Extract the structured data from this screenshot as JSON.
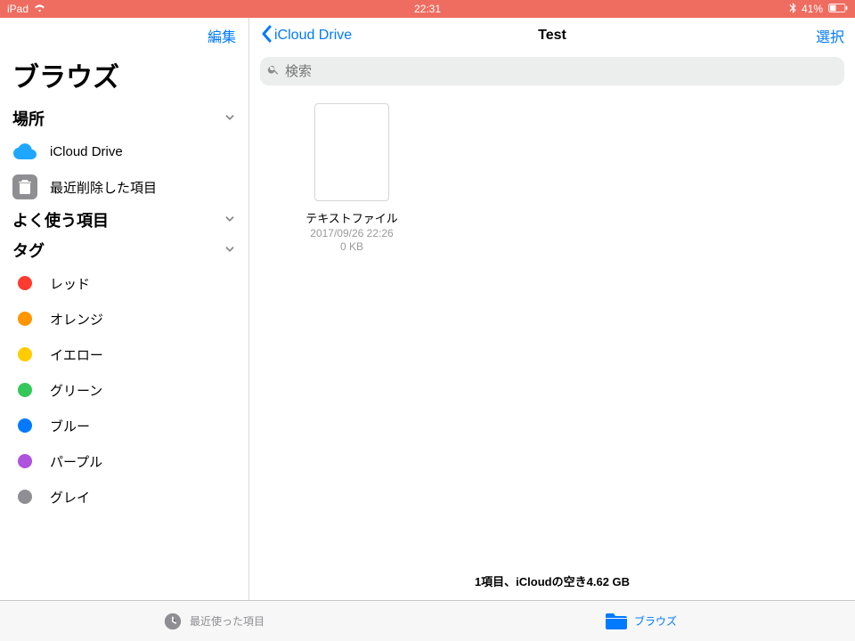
{
  "statusbar": {
    "device": "iPad",
    "time": "22:31",
    "battery_text": "41%"
  },
  "sidebar": {
    "edit_label": "編集",
    "title": "ブラウズ",
    "sections": {
      "locations": {
        "header": "場所"
      },
      "favorites": {
        "header": "よく使う項目"
      },
      "tags": {
        "header": "タグ"
      }
    },
    "locations": {
      "icloud": {
        "label": "iCloud Drive"
      },
      "recently_deleted": {
        "label": "最近削除した項目"
      }
    },
    "tags": [
      {
        "label": "レッド",
        "color": "#ff3b30"
      },
      {
        "label": "オレンジ",
        "color": "#ff9500"
      },
      {
        "label": "イエロー",
        "color": "#ffcc00"
      },
      {
        "label": "グリーン",
        "color": "#34c759"
      },
      {
        "label": "ブルー",
        "color": "#007aff"
      },
      {
        "label": "パープル",
        "color": "#af52de"
      },
      {
        "label": "グレイ",
        "color": "#8e8e93"
      }
    ]
  },
  "main": {
    "back_label": "iCloud Drive",
    "title": "Test",
    "select_label": "選択",
    "search_placeholder": "検索",
    "files": [
      {
        "name": "テキストファイル",
        "date": "2017/09/26 22:26",
        "size": "0 KB"
      }
    ],
    "footer_status": "1項目、iCloudの空き4.62 GB"
  },
  "tabbar": {
    "recents": {
      "label": "最近使った項目"
    },
    "browse": {
      "label": "ブラウズ"
    }
  }
}
